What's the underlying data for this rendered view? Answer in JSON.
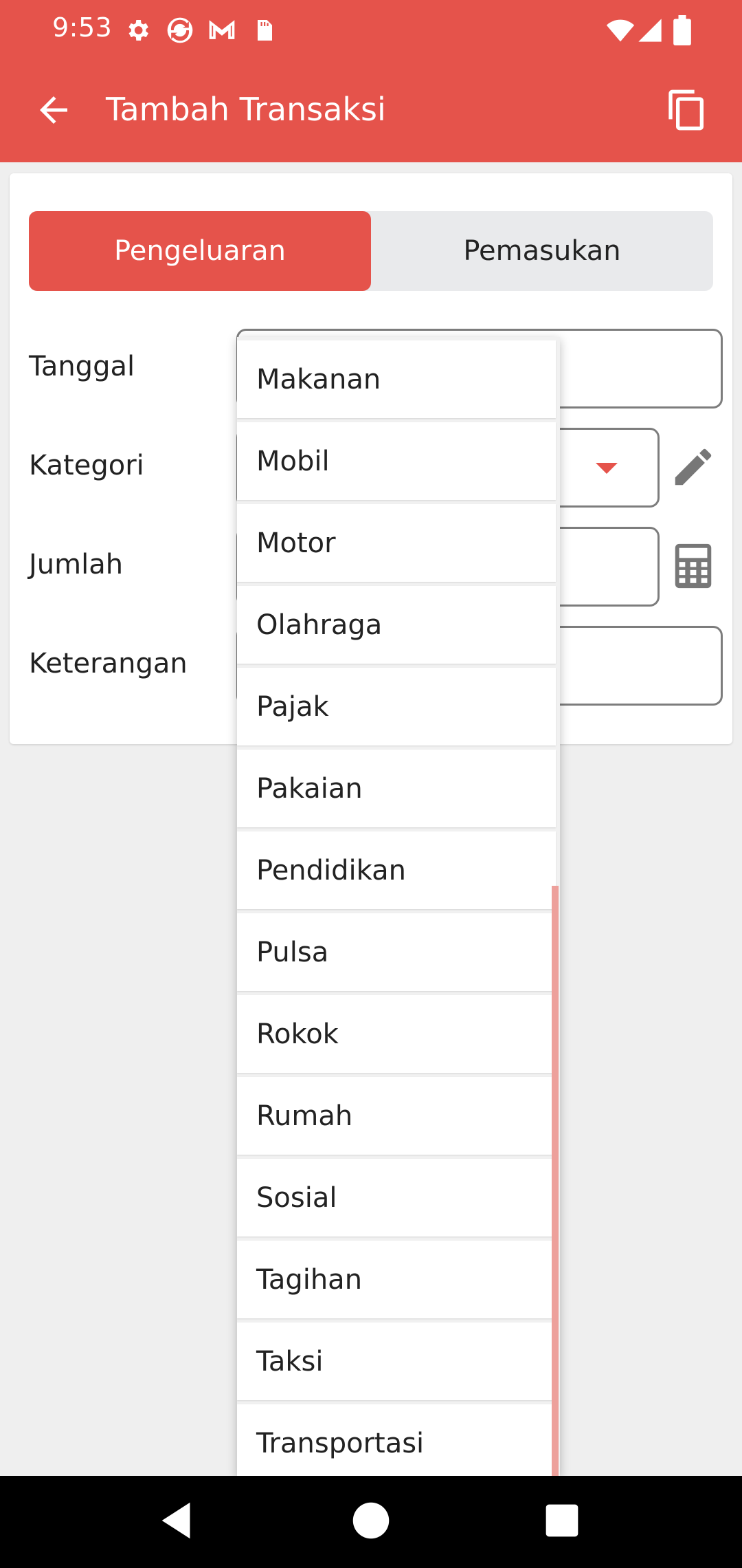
{
  "status_bar": {
    "time": "9:53",
    "left_icons": [
      "gear-icon",
      "sync-icon",
      "gmail-icon",
      "sd-card-icon"
    ],
    "right_icons": [
      "wifi-icon",
      "signal-icon",
      "battery-icon"
    ]
  },
  "app_bar": {
    "title": "Tambah Transaksi",
    "back_icon": "arrow-back-icon",
    "action_icon": "copy-icon"
  },
  "segmented": {
    "tabs": [
      {
        "label": "Pengeluaran",
        "active": true
      },
      {
        "label": "Pemasukan",
        "active": false
      }
    ]
  },
  "form": {
    "tanggal_label": "Tanggal",
    "kategori_label": "Kategori",
    "jumlah_label": "Jumlah",
    "keterangan_label": "Keterangan"
  },
  "dropdown": {
    "items": [
      "Makanan",
      "Mobil",
      "Motor",
      "Olahraga",
      "Pajak",
      "Pakaian",
      "Pendidikan",
      "Pulsa",
      "Rokok",
      "Rumah",
      "Sosial",
      "Tagihan",
      "Taksi",
      "Transportasi"
    ]
  },
  "colors": {
    "accent": "#e5534b",
    "background": "#efefef",
    "scrollbar": "#eda09b"
  },
  "nav_bar": {
    "icons": [
      "back-triangle-icon",
      "home-circle-icon",
      "recents-square-icon"
    ]
  }
}
